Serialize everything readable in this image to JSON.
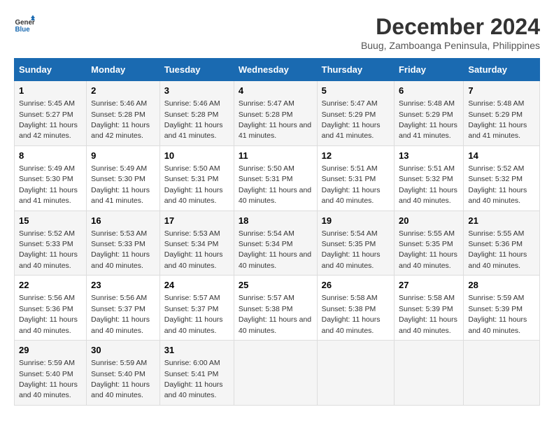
{
  "logo": {
    "line1": "General",
    "line2": "Blue"
  },
  "title": "December 2024",
  "subtitle": "Buug, Zamboanga Peninsula, Philippines",
  "days_of_week": [
    "Sunday",
    "Monday",
    "Tuesday",
    "Wednesday",
    "Thursday",
    "Friday",
    "Saturday"
  ],
  "weeks": [
    [
      {
        "day": "1",
        "sunrise": "Sunrise: 5:45 AM",
        "sunset": "Sunset: 5:27 PM",
        "daylight": "Daylight: 11 hours and 42 minutes."
      },
      {
        "day": "2",
        "sunrise": "Sunrise: 5:46 AM",
        "sunset": "Sunset: 5:28 PM",
        "daylight": "Daylight: 11 hours and 42 minutes."
      },
      {
        "day": "3",
        "sunrise": "Sunrise: 5:46 AM",
        "sunset": "Sunset: 5:28 PM",
        "daylight": "Daylight: 11 hours and 41 minutes."
      },
      {
        "day": "4",
        "sunrise": "Sunrise: 5:47 AM",
        "sunset": "Sunset: 5:28 PM",
        "daylight": "Daylight: 11 hours and 41 minutes."
      },
      {
        "day": "5",
        "sunrise": "Sunrise: 5:47 AM",
        "sunset": "Sunset: 5:29 PM",
        "daylight": "Daylight: 11 hours and 41 minutes."
      },
      {
        "day": "6",
        "sunrise": "Sunrise: 5:48 AM",
        "sunset": "Sunset: 5:29 PM",
        "daylight": "Daylight: 11 hours and 41 minutes."
      },
      {
        "day": "7",
        "sunrise": "Sunrise: 5:48 AM",
        "sunset": "Sunset: 5:29 PM",
        "daylight": "Daylight: 11 hours and 41 minutes."
      }
    ],
    [
      {
        "day": "8",
        "sunrise": "Sunrise: 5:49 AM",
        "sunset": "Sunset: 5:30 PM",
        "daylight": "Daylight: 11 hours and 41 minutes."
      },
      {
        "day": "9",
        "sunrise": "Sunrise: 5:49 AM",
        "sunset": "Sunset: 5:30 PM",
        "daylight": "Daylight: 11 hours and 41 minutes."
      },
      {
        "day": "10",
        "sunrise": "Sunrise: 5:50 AM",
        "sunset": "Sunset: 5:31 PM",
        "daylight": "Daylight: 11 hours and 40 minutes."
      },
      {
        "day": "11",
        "sunrise": "Sunrise: 5:50 AM",
        "sunset": "Sunset: 5:31 PM",
        "daylight": "Daylight: 11 hours and 40 minutes."
      },
      {
        "day": "12",
        "sunrise": "Sunrise: 5:51 AM",
        "sunset": "Sunset: 5:31 PM",
        "daylight": "Daylight: 11 hours and 40 minutes."
      },
      {
        "day": "13",
        "sunrise": "Sunrise: 5:51 AM",
        "sunset": "Sunset: 5:32 PM",
        "daylight": "Daylight: 11 hours and 40 minutes."
      },
      {
        "day": "14",
        "sunrise": "Sunrise: 5:52 AM",
        "sunset": "Sunset: 5:32 PM",
        "daylight": "Daylight: 11 hours and 40 minutes."
      }
    ],
    [
      {
        "day": "15",
        "sunrise": "Sunrise: 5:52 AM",
        "sunset": "Sunset: 5:33 PM",
        "daylight": "Daylight: 11 hours and 40 minutes."
      },
      {
        "day": "16",
        "sunrise": "Sunrise: 5:53 AM",
        "sunset": "Sunset: 5:33 PM",
        "daylight": "Daylight: 11 hours and 40 minutes."
      },
      {
        "day": "17",
        "sunrise": "Sunrise: 5:53 AM",
        "sunset": "Sunset: 5:34 PM",
        "daylight": "Daylight: 11 hours and 40 minutes."
      },
      {
        "day": "18",
        "sunrise": "Sunrise: 5:54 AM",
        "sunset": "Sunset: 5:34 PM",
        "daylight": "Daylight: 11 hours and 40 minutes."
      },
      {
        "day": "19",
        "sunrise": "Sunrise: 5:54 AM",
        "sunset": "Sunset: 5:35 PM",
        "daylight": "Daylight: 11 hours and 40 minutes."
      },
      {
        "day": "20",
        "sunrise": "Sunrise: 5:55 AM",
        "sunset": "Sunset: 5:35 PM",
        "daylight": "Daylight: 11 hours and 40 minutes."
      },
      {
        "day": "21",
        "sunrise": "Sunrise: 5:55 AM",
        "sunset": "Sunset: 5:36 PM",
        "daylight": "Daylight: 11 hours and 40 minutes."
      }
    ],
    [
      {
        "day": "22",
        "sunrise": "Sunrise: 5:56 AM",
        "sunset": "Sunset: 5:36 PM",
        "daylight": "Daylight: 11 hours and 40 minutes."
      },
      {
        "day": "23",
        "sunrise": "Sunrise: 5:56 AM",
        "sunset": "Sunset: 5:37 PM",
        "daylight": "Daylight: 11 hours and 40 minutes."
      },
      {
        "day": "24",
        "sunrise": "Sunrise: 5:57 AM",
        "sunset": "Sunset: 5:37 PM",
        "daylight": "Daylight: 11 hours and 40 minutes."
      },
      {
        "day": "25",
        "sunrise": "Sunrise: 5:57 AM",
        "sunset": "Sunset: 5:38 PM",
        "daylight": "Daylight: 11 hours and 40 minutes."
      },
      {
        "day": "26",
        "sunrise": "Sunrise: 5:58 AM",
        "sunset": "Sunset: 5:38 PM",
        "daylight": "Daylight: 11 hours and 40 minutes."
      },
      {
        "day": "27",
        "sunrise": "Sunrise: 5:58 AM",
        "sunset": "Sunset: 5:39 PM",
        "daylight": "Daylight: 11 hours and 40 minutes."
      },
      {
        "day": "28",
        "sunrise": "Sunrise: 5:59 AM",
        "sunset": "Sunset: 5:39 PM",
        "daylight": "Daylight: 11 hours and 40 minutes."
      }
    ],
    [
      {
        "day": "29",
        "sunrise": "Sunrise: 5:59 AM",
        "sunset": "Sunset: 5:40 PM",
        "daylight": "Daylight: 11 hours and 40 minutes."
      },
      {
        "day": "30",
        "sunrise": "Sunrise: 5:59 AM",
        "sunset": "Sunset: 5:40 PM",
        "daylight": "Daylight: 11 hours and 40 minutes."
      },
      {
        "day": "31",
        "sunrise": "Sunrise: 6:00 AM",
        "sunset": "Sunset: 5:41 PM",
        "daylight": "Daylight: 11 hours and 40 minutes."
      },
      null,
      null,
      null,
      null
    ]
  ]
}
